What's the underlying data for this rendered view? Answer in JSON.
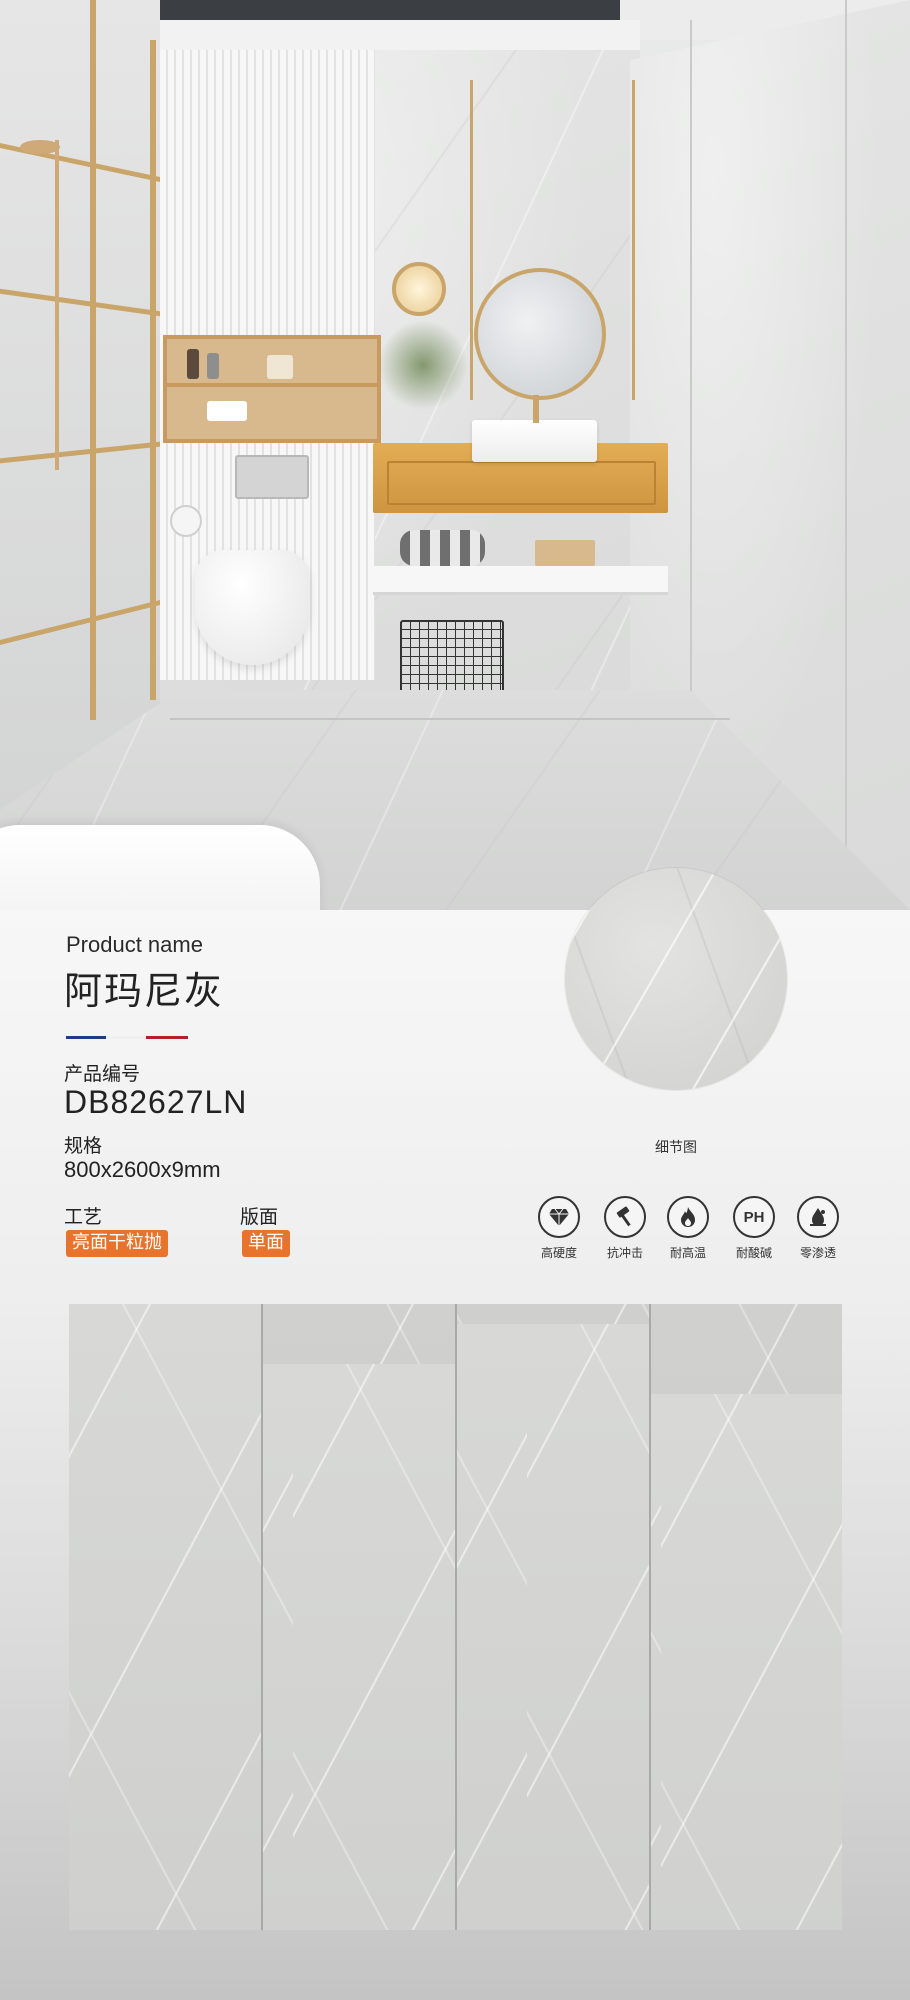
{
  "product": {
    "label_en": "Product name",
    "name_cn": "阿玛尼灰",
    "code_label": "产品编号",
    "code": "DB82627LN",
    "spec_label": "规格",
    "spec": "800x2600x9mm",
    "craft_label": "工艺",
    "craft": "亮面干粒抛",
    "face_label": "版面",
    "face": "单面"
  },
  "detail": {
    "caption": "细节图"
  },
  "features": [
    {
      "label": "高硬度",
      "icon": "diamond-icon"
    },
    {
      "label": "抗冲击",
      "icon": "hammer-icon"
    },
    {
      "label": "耐高温",
      "icon": "flame-icon"
    },
    {
      "label": "耐酸碱",
      "icon": "ph-icon",
      "glyph": "PH"
    },
    {
      "label": "零渗透",
      "icon": "water-drop-icon"
    }
  ],
  "colors": {
    "tag": "#e8732c",
    "flag_blue": "#1f3a8a",
    "flag_red": "#b3202a"
  }
}
